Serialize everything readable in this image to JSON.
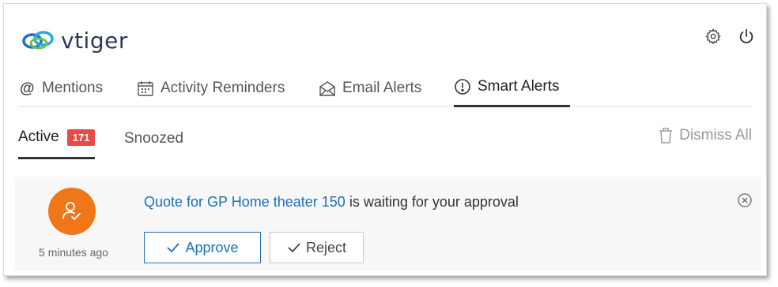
{
  "app": {
    "logo_text": "vtiger"
  },
  "header": {
    "settings_icon": "gear-icon",
    "power_icon": "power-icon"
  },
  "tabs": [
    {
      "label": "Mentions",
      "icon": "at-icon"
    },
    {
      "label": "Activity Reminders",
      "icon": "calendar-icon"
    },
    {
      "label": "Email Alerts",
      "icon": "envelope-icon"
    },
    {
      "label": "Smart Alerts",
      "icon": "exclamation-circle-icon",
      "active": true
    }
  ],
  "subtabs": {
    "active_label": "Active",
    "active_count": "171",
    "snoozed_label": "Snoozed",
    "dismiss_all_label": "Dismiss All"
  },
  "alert": {
    "link_text": "Quote for GP Home theater 150",
    "message_suffix": " is waiting for your approval",
    "time": "5 minutes ago",
    "approve_label": "Approve",
    "reject_label": "Reject"
  },
  "colors": {
    "accent": "#1d6fb8",
    "badge": "#e84a4a",
    "avatar": "#f07718"
  }
}
